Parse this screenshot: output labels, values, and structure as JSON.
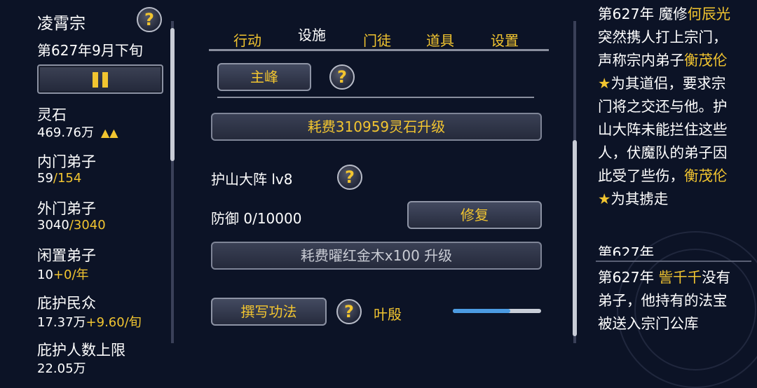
{
  "sidebar": {
    "sect_name": "凌霄宗",
    "date": "第627年9月下旬",
    "help_symbol": "?",
    "stats": [
      {
        "label": "灵石",
        "value": "469.76万",
        "trend": "▲▲"
      },
      {
        "label": "内门弟子",
        "value": "59",
        "value_extra": "/154"
      },
      {
        "label": "外门弟子",
        "value": "3040",
        "value_extra": "/3040"
      },
      {
        "label": "闲置弟子",
        "value": "10",
        "value_extra": "+0/年"
      },
      {
        "label": "庇护民众",
        "value": "17.37万",
        "value_extra": "+9.60/旬"
      },
      {
        "label": "庇护人数上限",
        "value": "22.05万"
      }
    ]
  },
  "tabs": [
    {
      "label": "行动"
    },
    {
      "label": "设施",
      "active": true
    },
    {
      "label": "门徒"
    },
    {
      "label": "道具"
    },
    {
      "label": "设置"
    }
  ],
  "facility": {
    "section_button": "主峰",
    "upgrade_cost_button": "耗费310959灵石升级",
    "array_name": "护山大阵 lv8",
    "defense": "防御 0/10000",
    "repair_button": "修复",
    "array_upgrade_button": "耗费曜红金木x100 升级",
    "write_skill_button": "撰写功法",
    "writer_name": "叶殷",
    "write_progress": 0.65
  },
  "event_log": [
    {
      "segments": [
        {
          "text": "第627年 魔修",
          "hl": false
        },
        {
          "text": "何辰光",
          "hl": true
        },
        {
          "text": "突然携人打上宗门，声称宗内弟子",
          "hl": false
        },
        {
          "text": "衡茂伦★",
          "hl": true
        },
        {
          "text": "为其道侣，要求宗门将之交还与他。护山大阵未能拦住这些人，伏魔队的弟子因此受了些伤，",
          "hl": false
        },
        {
          "text": "衡茂伦★",
          "hl": true
        },
        {
          "text": "为其掳走",
          "hl": false
        }
      ]
    },
    {
      "cut_text": "第627年"
    },
    {
      "segments": [
        {
          "text": "第627年 ",
          "hl": false
        },
        {
          "text": "訾千千",
          "hl": true
        },
        {
          "text": "没有弟子，他持有的法宝被送入宗门公库",
          "hl": false
        }
      ]
    }
  ],
  "colors": {
    "accent": "#f2c530",
    "background": "#0c1326",
    "progress": "#4c9be2"
  }
}
